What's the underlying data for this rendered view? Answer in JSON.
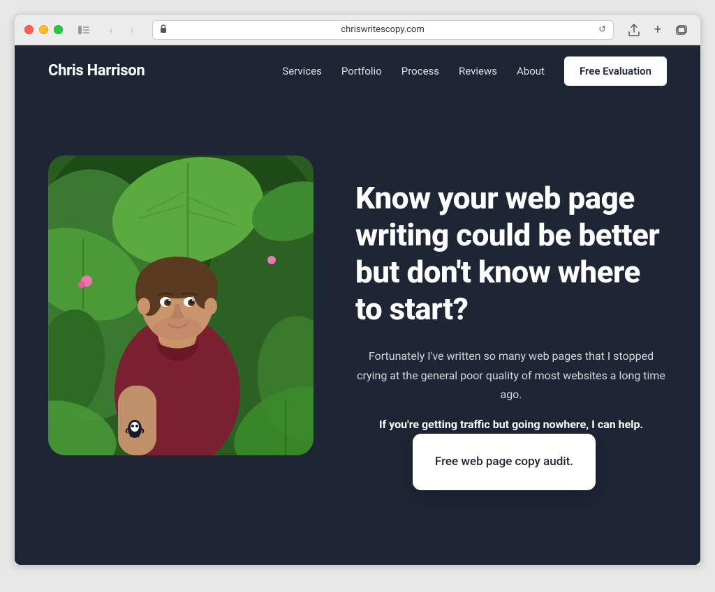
{
  "browser": {
    "url": "chriswritescopy.com",
    "traffic_lights": [
      "red",
      "yellow",
      "green"
    ]
  },
  "site": {
    "logo": "Chris Harrison",
    "nav": {
      "links": [
        "Services",
        "Portfolio",
        "Process",
        "Reviews",
        "About"
      ],
      "cta": "Free Evaluation"
    },
    "hero": {
      "headline": "Know your web page writing could be better but don't know where to start?",
      "subtext": "Fortunately I've written so many web pages that I stopped crying at the general poor quality of most websites a long time ago.",
      "cta_text": "If you're getting traffic but going nowhere, I can help.",
      "floating_card": "Free web page copy audit."
    }
  }
}
